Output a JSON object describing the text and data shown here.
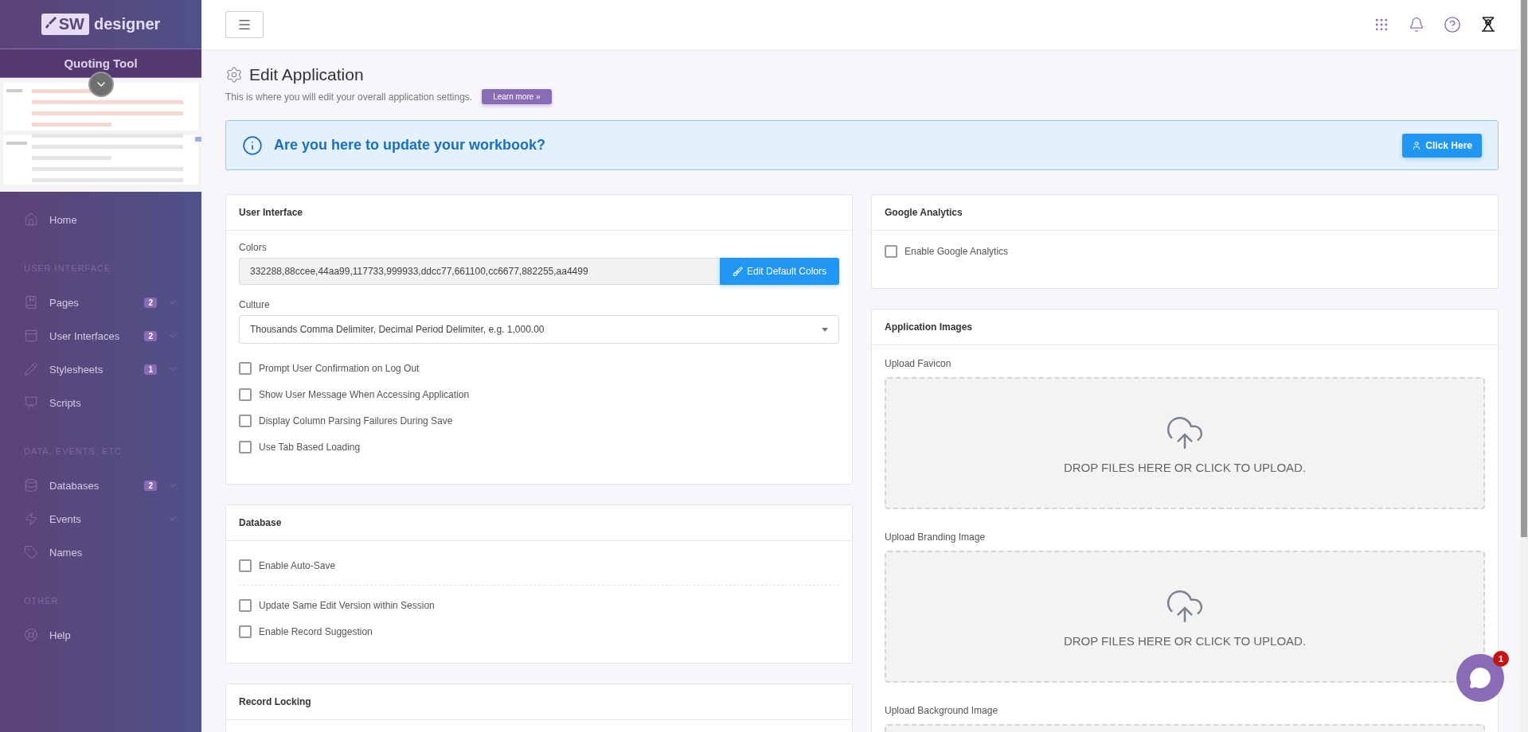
{
  "sidebar": {
    "logo": {
      "badge": "SW",
      "text": "designer"
    },
    "project": "Quoting Tool",
    "groups": [
      {
        "items": [
          {
            "label": "Home",
            "expandable": false
          }
        ]
      },
      {
        "heading": "USER INTERFACE",
        "items": [
          {
            "label": "Pages",
            "badge": "2",
            "expandable": true
          },
          {
            "label": "User Interfaces",
            "badge": "2",
            "expandable": true
          },
          {
            "label": "Stylesheets",
            "badge": "1",
            "expandable": true
          },
          {
            "label": "Scripts",
            "expandable": false
          }
        ]
      },
      {
        "heading": "DATA, EVENTS, ETC.",
        "items": [
          {
            "label": "Databases",
            "badge": "2",
            "expandable": true
          },
          {
            "label": "Events",
            "expandable": true
          },
          {
            "label": "Names",
            "expandable": false
          }
        ]
      },
      {
        "heading": "OTHER",
        "items": [
          {
            "label": "Help",
            "expandable": false
          }
        ]
      }
    ]
  },
  "page": {
    "title": "Edit Application",
    "subtitle": "This is where you will edit your overall application settings.",
    "learn_more": "Learn more »"
  },
  "banner": {
    "text": "Are you here to update your workbook?",
    "button": "Click Here"
  },
  "user_interface": {
    "title": "User Interface",
    "colors_label": "Colors",
    "colors_value": "332288,88ccee,44aa99,117733,999933,ddcc77,661100,cc6677,882255,aa4499",
    "colors_button": "Edit Default Colors",
    "culture_label": "Culture",
    "culture_value": "Thousands Comma Delimiter, Decimal Period Delimiter, e.g. 1,000.00",
    "checkboxes": [
      {
        "label": "Prompt User Confirmation on Log Out",
        "checked": false
      },
      {
        "label": "Show User Message When Accessing Application",
        "checked": false
      },
      {
        "label": "Display Column Parsing Failures During Save",
        "checked": false
      },
      {
        "label": "Use Tab Based Loading",
        "checked": false
      }
    ]
  },
  "database": {
    "title": "Database",
    "checkbox_groups": [
      [
        {
          "label": "Enable Auto-Save",
          "checked": false
        }
      ],
      [
        {
          "label": "Update Same Edit Version within Session",
          "checked": false
        },
        {
          "label": "Enable Record Suggestion",
          "checked": false
        }
      ]
    ]
  },
  "record_locking": {
    "title": "Record Locking"
  },
  "google_analytics": {
    "title": "Google Analytics",
    "checkboxes": [
      {
        "label": "Enable Google Analytics",
        "checked": false
      }
    ]
  },
  "application_images": {
    "title": "Application Images",
    "uploads": [
      {
        "label": "Upload Favicon",
        "prompt": "DROP FILES HERE OR CLICK TO UPLOAD."
      },
      {
        "label": "Upload Branding Image",
        "prompt": "DROP FILES HERE OR CLICK TO UPLOAD."
      },
      {
        "label": "Upload Background Image"
      }
    ]
  },
  "chat": {
    "badge": "1"
  }
}
